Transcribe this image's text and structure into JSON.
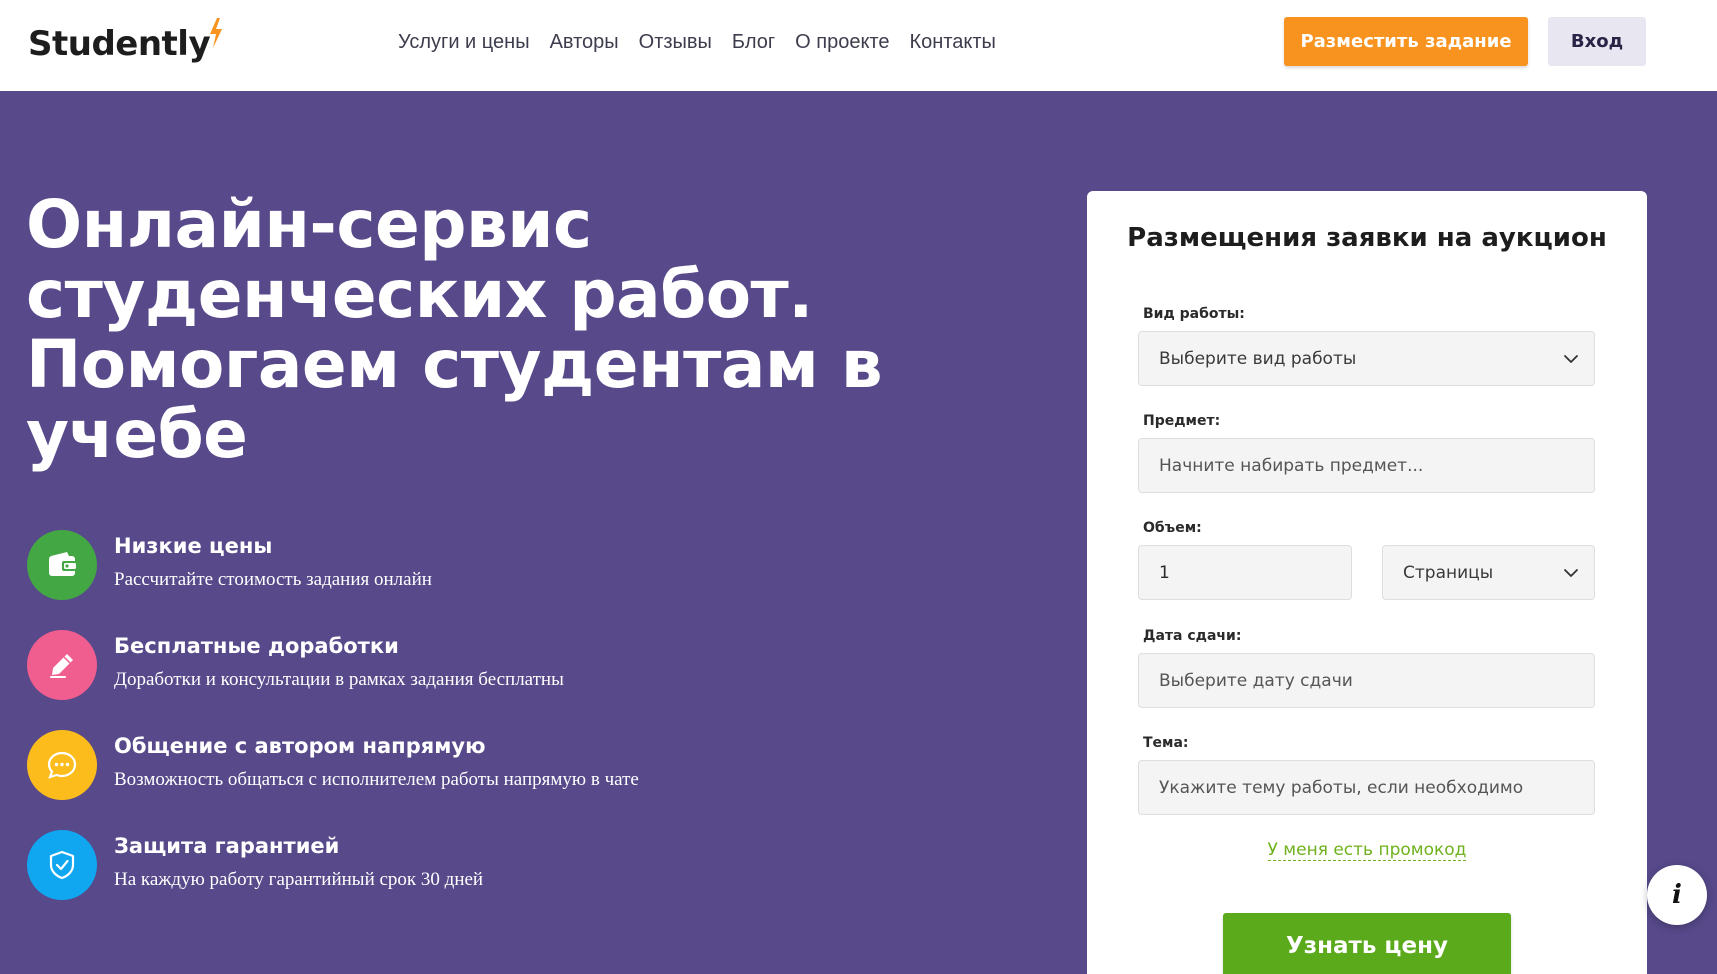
{
  "header": {
    "logo_text": "Studently",
    "nav": [
      "Услуги и цены",
      "Авторы",
      "Отзывы",
      "Блог",
      "О проекте",
      "Контакты"
    ],
    "post_button": "Разместить задание",
    "login_button": "Вход"
  },
  "hero": {
    "title": "Онлайн-сервис студенческих работ. Помогаем студентам в учебе",
    "features": [
      {
        "title": "Низкие цены",
        "desc": "Рассчитайте стоимость задания онлайн",
        "color": "#43a744",
        "icon": "wallet-icon"
      },
      {
        "title": "Бесплатные доработки",
        "desc": "Доработки и консультации в рамках задания бесплатны",
        "color": "#ef5e8f",
        "icon": "pencil-icon"
      },
      {
        "title": "Общение с автором напрямую",
        "desc": "Возможность общаться с исполнителем работы напрямую в чате",
        "color": "#fbbc1c",
        "icon": "chat-icon"
      },
      {
        "title": "Защита гарантией",
        "desc": "На каждую работу гарантийный срок 30 дней",
        "color": "#11a6f0",
        "icon": "shield-icon"
      }
    ]
  },
  "form": {
    "title": "Размещения заявки на аукцион",
    "work_type": {
      "label": "Вид работы:",
      "value": "Выберите вид работы"
    },
    "subject": {
      "label": "Предмет:",
      "placeholder": "Начните набирать предмет..."
    },
    "volume": {
      "label": "Объем:",
      "value": "1",
      "unit": "Страницы"
    },
    "deadline": {
      "label": "Дата сдачи:",
      "placeholder": "Выберите дату сдачи"
    },
    "topic": {
      "label": "Тема:",
      "placeholder": "Укажите тему работы, если необходимо"
    },
    "promo_link": "У меня есть промокод",
    "submit_button": "Узнать цену"
  },
  "info_button": "i",
  "colors": {
    "accent_orange": "#f7931e",
    "accent_green": "#5aaa1c",
    "background_purple": "#57498a"
  }
}
